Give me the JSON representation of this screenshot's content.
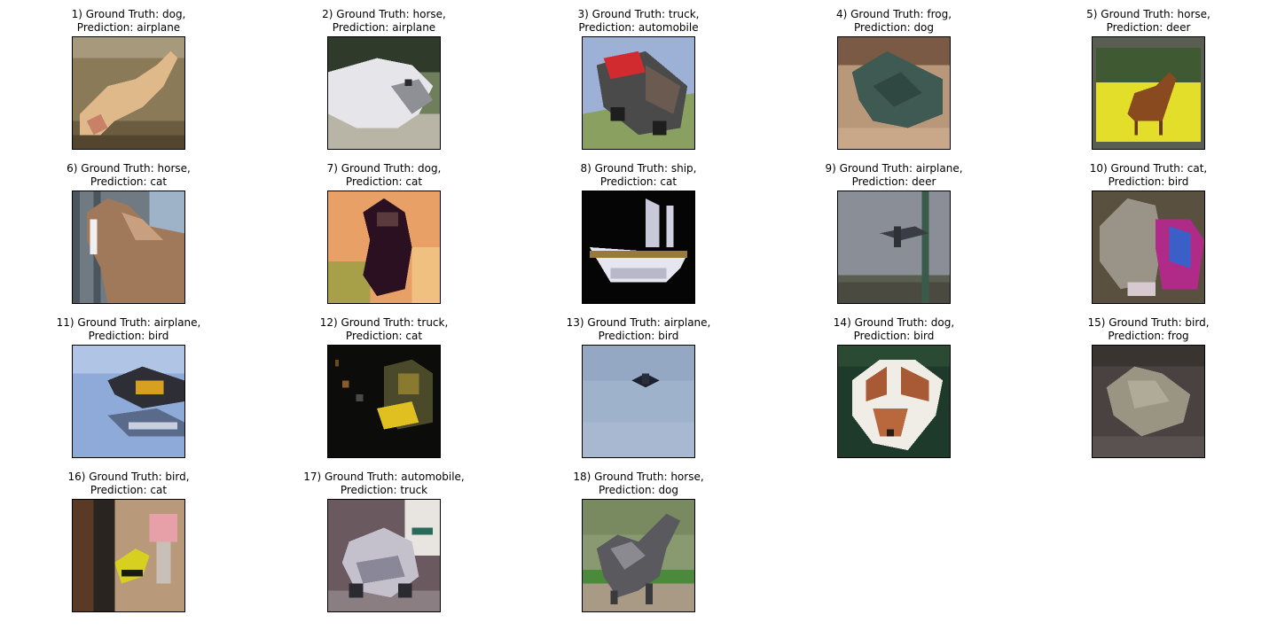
{
  "panels": [
    {
      "title": "1) Ground Truth: dog,",
      "prediction": "Prediction: airplane",
      "image": "photo-dog-running-on-grass"
    },
    {
      "title": "2) Ground Truth: horse,",
      "prediction": "Prediction: airplane",
      "image": "photo-white-horse-head"
    },
    {
      "title": "3) Ground Truth: truck,",
      "prediction": "Prediction: automobile",
      "image": "photo-red-truck-on-slope"
    },
    {
      "title": "4) Ground Truth: frog,",
      "prediction": "Prediction: dog",
      "image": "photo-green-frog"
    },
    {
      "title": "5) Ground Truth: horse,",
      "prediction": "Prediction: deer",
      "image": "photo-brown-horse-yellow-field"
    },
    {
      "title": "6) Ground Truth: horse,",
      "prediction": "Prediction: cat",
      "image": "photo-horse-by-fence"
    },
    {
      "title": "7) Ground Truth: dog,",
      "prediction": "Prediction: cat",
      "image": "photo-dark-dog-orange-background"
    },
    {
      "title": "8) Ground Truth: ship,",
      "prediction": "Prediction: cat",
      "image": "photo-white-boat-black-background"
    },
    {
      "title": "9) Ground Truth: airplane,",
      "prediction": "Prediction: deer",
      "image": "photo-airplane-grey-sky"
    },
    {
      "title": "10) Ground Truth: cat,",
      "prediction": "Prediction: bird",
      "image": "photo-grey-cat-pink-blue-object"
    },
    {
      "title": "11) Ground Truth: airplane,",
      "prediction": "Prediction: bird",
      "image": "photo-seaplane-blue-sky"
    },
    {
      "title": "12) Ground Truth: truck,",
      "prediction": "Prediction: cat",
      "image": "photo-yellow-truck-at-night"
    },
    {
      "title": "13) Ground Truth: airplane,",
      "prediction": "Prediction: bird",
      "image": "photo-distant-aircraft-blue-sky"
    },
    {
      "title": "14) Ground Truth: dog,",
      "prediction": "Prediction: bird",
      "image": "photo-brown-white-dog"
    },
    {
      "title": "15) Ground Truth: bird,",
      "prediction": "Prediction: frog",
      "image": "photo-bird-on-ground"
    },
    {
      "title": "16) Ground Truth: bird,",
      "prediction": "Prediction: cat",
      "image": "photo-yellow-black-bird"
    },
    {
      "title": "17) Ground Truth: automobile,",
      "prediction": "Prediction: truck",
      "image": "photo-wrecked-car"
    },
    {
      "title": "18) Ground Truth: horse,",
      "prediction": "Prediction: dog",
      "image": "photo-grey-horse-galloping"
    }
  ]
}
